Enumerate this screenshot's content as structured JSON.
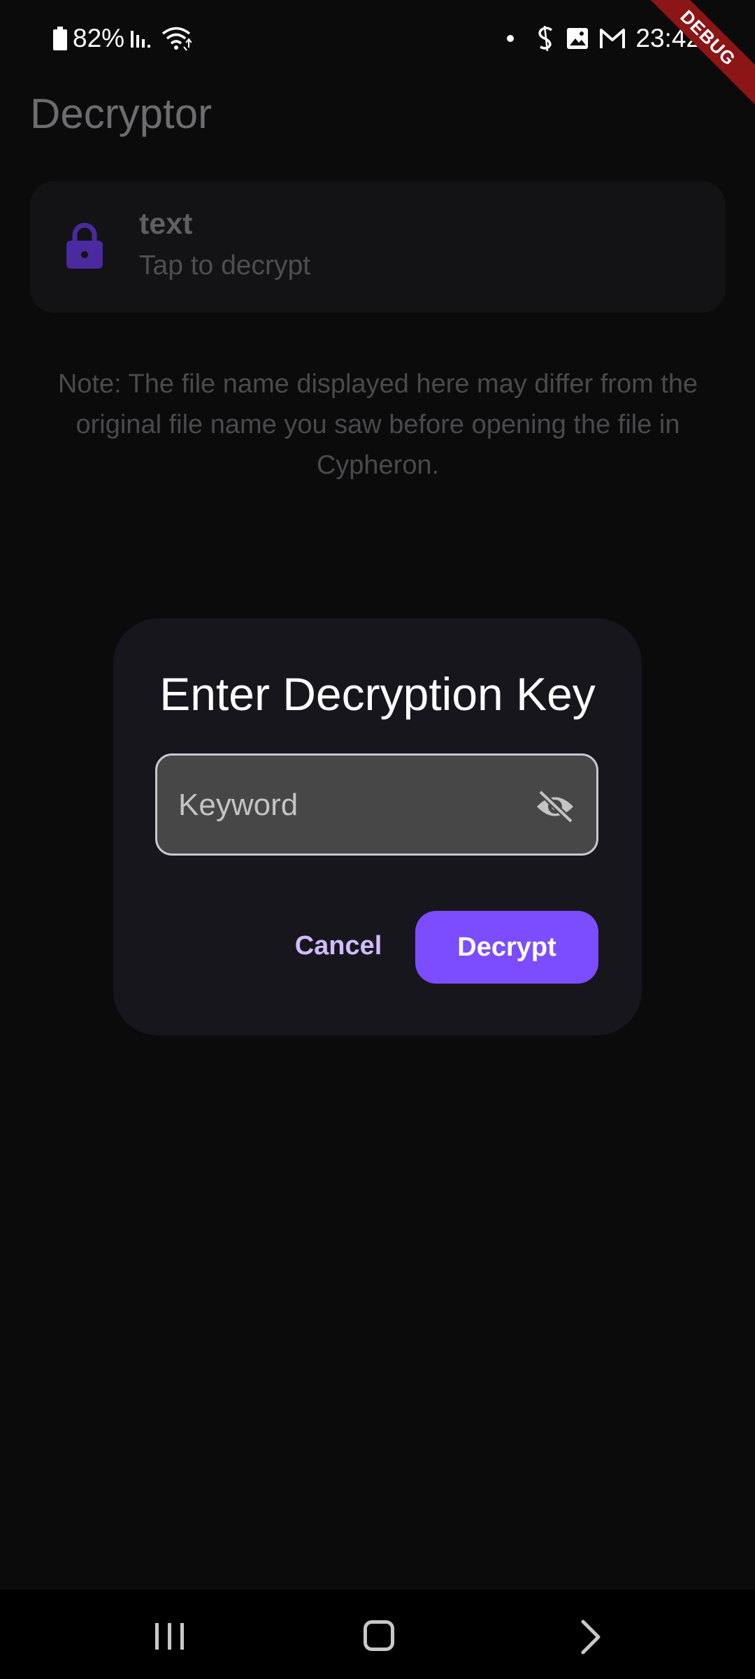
{
  "status_bar": {
    "battery": "82%",
    "time": "23:42"
  },
  "debug_banner": "DEBUG",
  "app": {
    "title": "Decryptor",
    "file_card": {
      "name": "text",
      "subtitle": "Tap to decrypt",
      "icon": "lock-icon"
    },
    "note": "Note: The file name displayed here may differ from the original file name you saw before opening the file in Cypheron."
  },
  "dialog": {
    "title": "Enter Decryption Key",
    "input": {
      "placeholder": "Keyword",
      "value": "",
      "toggle_icon": "eye-off-icon"
    },
    "cancel_label": "Cancel",
    "decrypt_label": "Decrypt"
  },
  "colors": {
    "accent": "#7c4dff",
    "accent_text": "#d0bcff",
    "lock_icon": "#4a2a9e",
    "background": "#0b0b0c",
    "dialog_bg": "#18161d",
    "debug_banner": "#8c1616"
  },
  "nav_bar": {
    "icons": [
      "recents-icon",
      "home-icon",
      "back-icon"
    ]
  }
}
